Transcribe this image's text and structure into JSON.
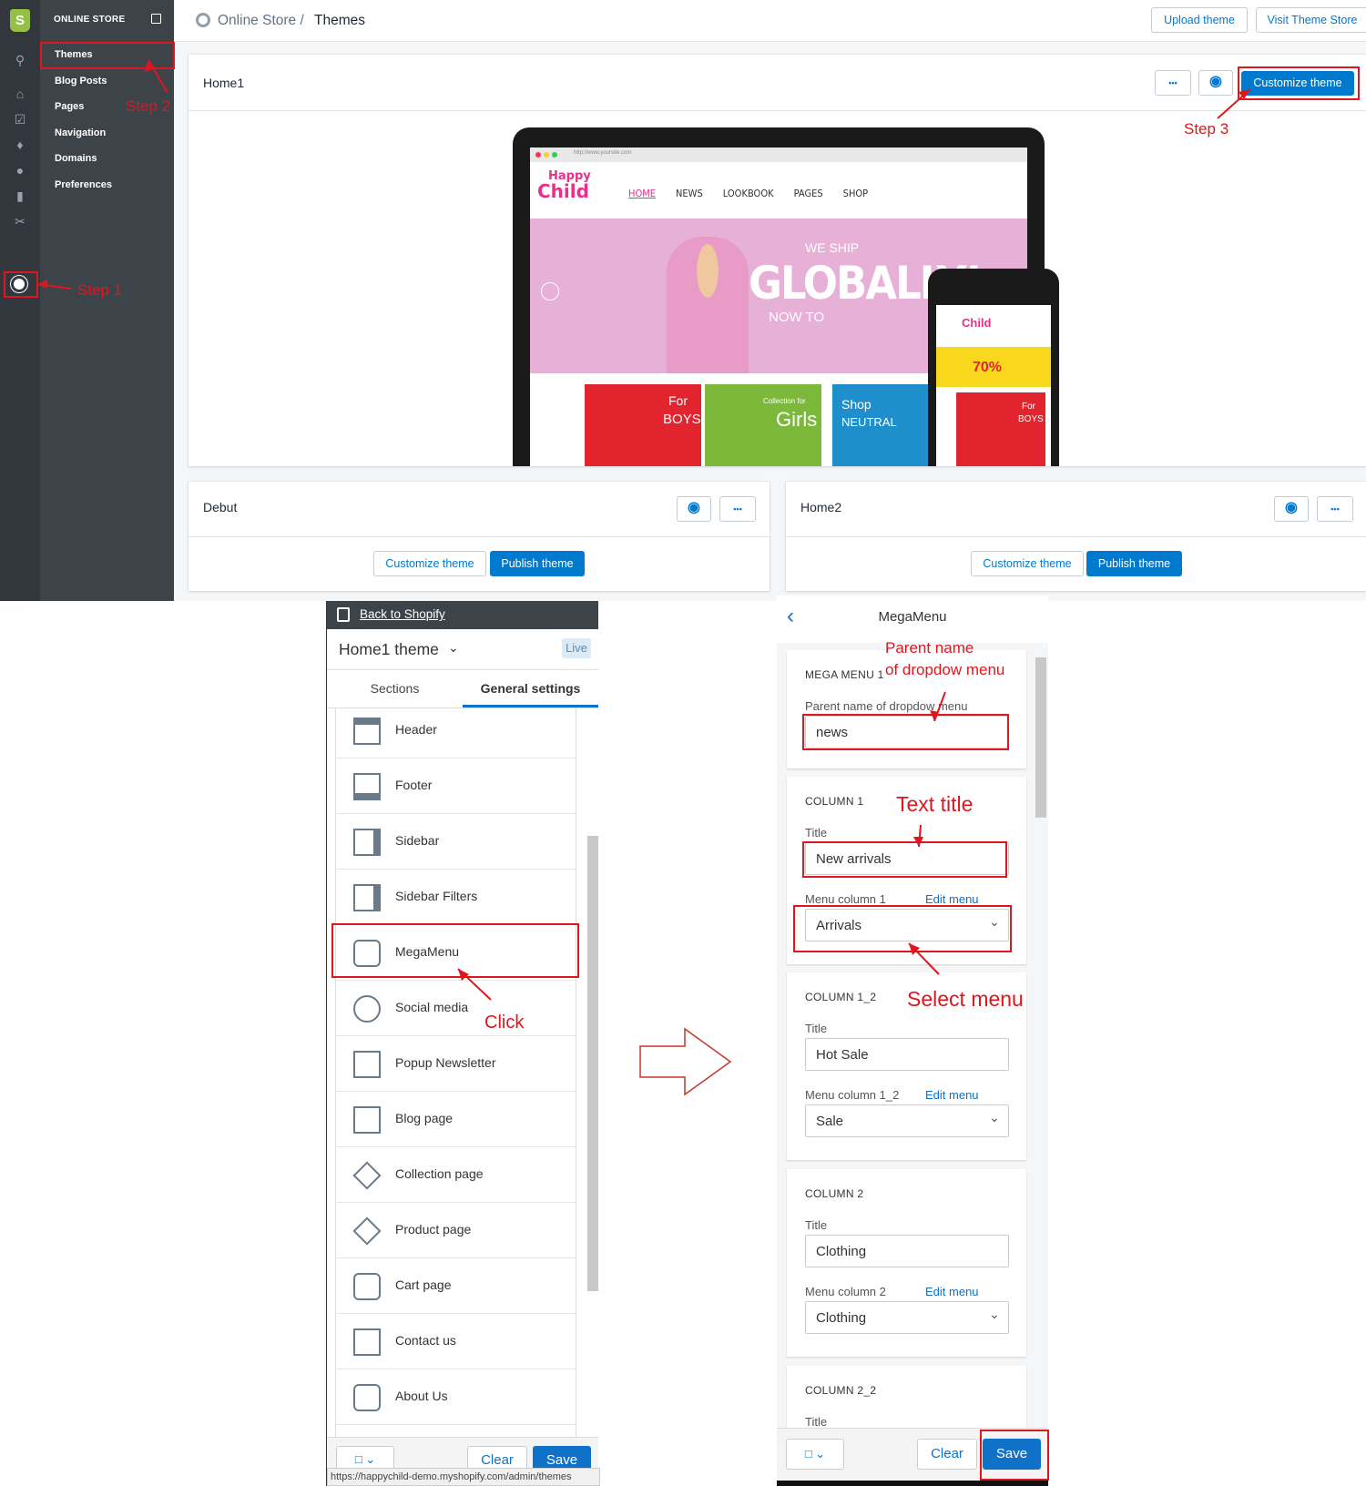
{
  "admin": {
    "store_section": "ONLINE STORE",
    "nav_items": [
      "Themes",
      "Blog Posts",
      "Pages",
      "Navigation",
      "Domains",
      "Preferences"
    ],
    "breadcrumb_parent": "Online Store /",
    "breadcrumb_current": "Themes",
    "upload_theme": "Upload theme",
    "visit_store": "Visit Theme Store",
    "current_theme": {
      "name": "Home1",
      "customize": "Customize theme"
    },
    "themes": [
      {
        "name": "Debut",
        "customize": "Customize theme",
        "publish": "Publish theme"
      },
      {
        "name": "Home2",
        "customize": "Customize theme",
        "publish": "Publish theme"
      }
    ],
    "ellipsis": "•••"
  },
  "preview": {
    "url": "http://www.yoursite.com",
    "brand_top": "Happy",
    "brand_bottom": "Child",
    "nav": [
      "HOME",
      "NEWS",
      "LOOKBOOK",
      "PAGES",
      "SHOP"
    ],
    "hero_small": "WE SHIP",
    "hero_big": "GLOBALLY!",
    "hero_sub": "NOW TO",
    "banners": [
      {
        "l1": "For",
        "l2": "BOYS",
        "color": "#e2242f"
      },
      {
        "l1": "Collection for",
        "l2": "Girls",
        "color": "#7cb93b"
      },
      {
        "l1": "Shop",
        "l2": "NEUTRAL",
        "color": "#1f8fcb"
      }
    ],
    "phone_sale": "70%",
    "phone_banner": {
      "l1": "For",
      "l2": "BOYS"
    }
  },
  "annotations": {
    "step1": "Step 1",
    "step2": "Step 2",
    "step3": "Step 3",
    "click": "Click",
    "parent_name": "Parent name",
    "of_dropdown": "of dropdow menu",
    "text_title": "Text title",
    "select_menu": "Select menu"
  },
  "editor": {
    "back": "Back to Shopify",
    "theme_title": "Home1 theme",
    "live": "Live",
    "tabs": [
      "Sections",
      "General settings"
    ],
    "sections": [
      "Header",
      "Footer",
      "Sidebar",
      "Sidebar Filters",
      "MegaMenu",
      "Social media",
      "Popup Newsletter",
      "Blog page",
      "Collection page",
      "Product page",
      "Cart page",
      "Contact us",
      "About Us"
    ],
    "clear": "Clear",
    "save": "Save",
    "status_url": "https://happychild-demo.myshopify.com/admin/themes"
  },
  "megamenu": {
    "title": "MegaMenu",
    "edit_menu": "Edit menu",
    "cards": [
      {
        "heading": "MEGA MENU 1",
        "label": "Parent name of dropdow menu",
        "value": "news"
      },
      {
        "heading": "COLUMN 1",
        "title_label": "Title",
        "title_value": "New arrivals",
        "menu_label": "Menu column 1",
        "menu_value": "Arrivals"
      },
      {
        "heading": "COLUMN 1_2",
        "title_label": "Title",
        "title_value": "Hot Sale",
        "menu_label": "Menu column 1_2",
        "menu_value": "Sale"
      },
      {
        "heading": "COLUMN 2",
        "title_label": "Title",
        "title_value": "Clothing",
        "menu_label": "Menu column 2",
        "menu_value": "Clothing"
      },
      {
        "heading": "COLUMN 2_2",
        "title_label": "Title"
      }
    ],
    "clear": "Clear",
    "save": "Save"
  },
  "colors": {
    "accent": "#007ace",
    "annotation": "#e0161e",
    "sidebar": "#3d4449"
  }
}
